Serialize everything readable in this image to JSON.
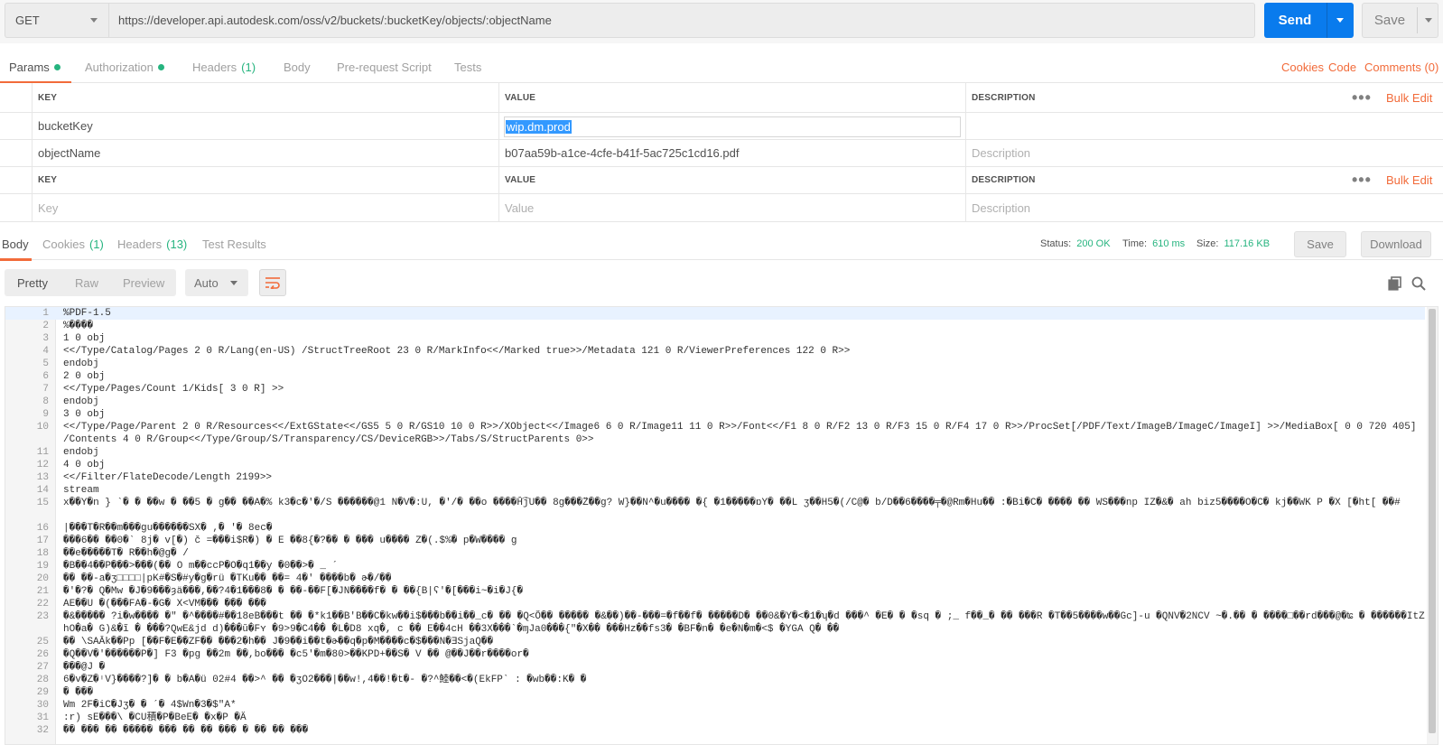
{
  "request": {
    "method": "GET",
    "url": "https://developer.api.autodesk.com/oss/v2/buckets/:bucketKey/objects/:objectName",
    "send_label": "Send",
    "save_label": "Save"
  },
  "request_tabs": [
    {
      "label": "Params",
      "active": true,
      "dot": true
    },
    {
      "label": "Authorization",
      "dot": true
    },
    {
      "label": "Headers",
      "count": "(1)"
    },
    {
      "label": "Body"
    },
    {
      "label": "Pre-request Script"
    },
    {
      "label": "Tests"
    }
  ],
  "request_links": {
    "cookies": "Cookies",
    "code": "Code",
    "comments": "Comments (0)"
  },
  "path_params": {
    "headers": {
      "key": "KEY",
      "value": "VALUE",
      "description": "DESCRIPTION"
    },
    "bulk_edit": "Bulk Edit",
    "rows": [
      {
        "key": "bucketKey",
        "value": "wip.dm.prod",
        "description": ""
      },
      {
        "key": "objectName",
        "value": "b07aa59b-a1ce-4cfe-b41f-5ac725c1cd16.pdf",
        "description_placeholder": "Description"
      }
    ]
  },
  "query_params": {
    "headers": {
      "key": "KEY",
      "value": "VALUE",
      "description": "DESCRIPTION"
    },
    "bulk_edit": "Bulk Edit",
    "new_row": {
      "key_placeholder": "Key",
      "value_placeholder": "Value",
      "description_placeholder": "Description"
    }
  },
  "response_tabs": [
    {
      "label": "Body",
      "active": true
    },
    {
      "label": "Cookies",
      "count": "(1)"
    },
    {
      "label": "Headers",
      "count": "(13)"
    },
    {
      "label": "Test Results"
    }
  ],
  "response_meta": {
    "status_label": "Status:",
    "status_value": "200 OK",
    "time_label": "Time:",
    "time_value": "610 ms",
    "size_label": "Size:",
    "size_value": "117.16 KB",
    "save_label": "Save",
    "download_label": "Download"
  },
  "body_toolbar": {
    "views": [
      "Pretty",
      "Raw",
      "Preview"
    ],
    "format": "Auto"
  },
  "colors": {
    "accent": "#f26b3a",
    "primary": "#097bed",
    "success": "#26b47f"
  },
  "code_lines": [
    {
      "n": "1",
      "t": "%PDF-1.5"
    },
    {
      "n": "2",
      "t": "%����"
    },
    {
      "n": "3",
      "t": "1 0 obj"
    },
    {
      "n": "4",
      "t": "<</Type/Catalog/Pages 2 0 R/Lang(en-US) /StructTreeRoot 23 0 R/MarkInfo<</Marked true>>/Metadata 121 0 R/ViewerPreferences 122 0 R>>"
    },
    {
      "n": "5",
      "t": "endobj"
    },
    {
      "n": "6",
      "t": "2 0 obj"
    },
    {
      "n": "7",
      "t": "<</Type/Pages/Count 1/Kids[ 3 0 R] >>"
    },
    {
      "n": "8",
      "t": "endobj"
    },
    {
      "n": "9",
      "t": "3 0 obj"
    },
    {
      "n": "10",
      "t": "<</Type/Page/Parent 2 0 R/Resources<</ExtGState<</GS5 5 0 R/GS10 10 0 R>>/XObject<</Image6 6 0 R/Image11 11 0 R>>/Font<</F1 8 0 R/F2 13 0 R/F3 15 0 R/F4 17 0 R>>/ProcSet[/PDF/Text/ImageB/ImageC/ImageI] >>/MediaBox[ 0 0 720 405] /Contents 4 0 R/Group<</Type/Group/S/Transparency/CS/DeviceRGB>>/Tabs/S/StructParents 0>>"
    },
    {
      "n": "11",
      "t": "endobj"
    },
    {
      "n": "12",
      "t": "4 0 obj"
    },
    {
      "n": "13",
      "t": "<</Filter/FlateDecode/Length 2199>>"
    },
    {
      "n": "14",
      "t": "stream"
    },
    {
      "n": "15",
      "t": "x��Y�n } `� � ��w � ��5 � g�� ��A�% k3�c�'�/S ������@1 N�V�:U, �'/� ��o ����Ȟ͡jU�� 8g���̆Z��g? W}��N^�u���� �{ �1�����ɒY� ��L ʒ��H5�(/C@� b/D��6����╤�@Rm�Hu�� :�Bi�C� ���� �� WS���np IZ�&� ah biz5����O�C� kj��WK P �X [�ht[ ��#"
    },
    {
      "n": "16",
      "t": "|���T�R��m���gu������SX� ,� '� 8ec�"
    },
    {
      "n": "17",
      "t": "���6�� ��0�` 8j� v[�) č =���i$R�) � E ��8{�?�� � ��� u���� Z�(.$%� p�W���� g"
    },
    {
      "n": "18",
      "t": "��e�����T� R��h�@g� /"
    },
    {
      "n": "19",
      "t": "�B��4��P���>���(�� O m��ccP�O�q1��y �0��>� _ ´"
    },
    {
      "n": "20",
      "t": "�� ��-a�ʒ□□□□|pK#�S�#y�g�rü �TKu�� ��= 4�' ����b� ɚ�/��"
    },
    {
      "n": "21",
      "t": "�'�?� Q�Mw �J�9���ȝä���,��?4�1���8� � ��-��F[�JN����f� � ��{B|ʕ'�[���i~�i�J{�"
    },
    {
      "n": "22",
      "t": "AE��U �(���FA�-�G� X<VM��� ��� ���"
    },
    {
      "n": "23",
      "t": "�&����� ?i�w���� �\" �^����#��18eB���t �� �*k1��B'B��C�kw��i$���b��i��_c� �� �Q<Õ�� ����� �&��)��-���=�f��f� �����D� ��0&�Y�<�1�ʮ�d ���^ �E� � �sq � ;_ f��_� �� ���R �T��5����w��Gc]-u �QNV�2NCV ~�.�� � ����□��rd���@�ʨ � ������ItZhO�a� G)&�ĩ � ���?QwE&jd d)���ŭ�Fʏ �9>9�C4�� �L�D8 xq�, c �� E��4cH ��3X���`�ɱJa0���{\"�X�� ���Hz��fs3� �BF�n� �e�N�m�<$ �YGA Q� ��"
    },
    {
      "n": "25",
      "t": "�� \\SAĀk��Pp [��F�E��ZF�� ���2�h�� J�9��i��t�ɚ��q�p�M����c�$���N�ƎSjaQ��"
    },
    {
      "n": "26",
      "t": "�Q��V�'������P�] F3 �pg ��2m ��,bo��� �c5'�m�80>��KPD+��S� V �� @��J��r����or�"
    },
    {
      "n": "27",
      "t": "���@J �"
    },
    {
      "n": "28",
      "t": "6�v�Z�ᶦV}����?]� � b�A�ü 02#4 ��>^ �� �ʒO2���|��w!,4��!�t�- �?^鯥��<�(EkFP` : �wb��:K� �"
    },
    {
      "n": "29",
      "t": "� ���"
    },
    {
      "n": "30",
      "t": "Wm 2F�iC�Jʒ� � ´� 4$Wn�3�$\"A*"
    },
    {
      "n": "31",
      "t": ":r) sE���\\ �CU積�P�BeE� �x�P �Ä"
    },
    {
      "n": "32",
      "t": "�� ��� �� ����� ��� �� �� ��� � �� �� ���"
    }
  ]
}
